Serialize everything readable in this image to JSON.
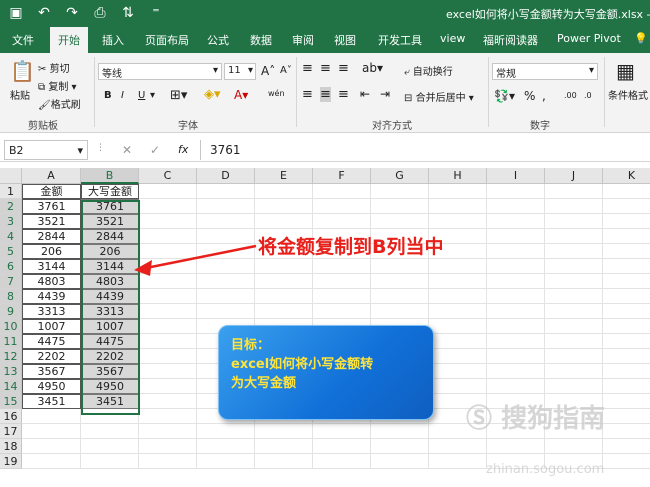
{
  "title_bar": {
    "doc_title": "excel如何将小写金额转为大写金额.xlsx - Exce",
    "qat": [
      "save-icon",
      "undo-icon",
      "redo-icon",
      "print-preview-icon",
      "sort-icon",
      "customize-icon"
    ]
  },
  "tabs": [
    "文件",
    "开始",
    "插入",
    "页面布局",
    "公式",
    "数据",
    "审阅",
    "视图",
    "开发工具",
    "view",
    "福昕阅读器",
    "Power Pivot",
    "💡"
  ],
  "active_tab_index": 1,
  "ribbon": {
    "clipboard": {
      "paste": "粘贴",
      "cut": "剪切",
      "copy": "复制",
      "format_painter": "格式刷",
      "label": "剪贴板"
    },
    "font": {
      "name": "等线",
      "size": "11",
      "grow": "A",
      "shrink": "A",
      "bold": "B",
      "italic": "I",
      "underline": "U",
      "wen": "wén",
      "color_a": "A",
      "label": "字体"
    },
    "alignment": {
      "wrap": "自动换行",
      "merge": "合并后居中",
      "label": "对齐方式"
    },
    "number": {
      "format": "常规",
      "percent": "%",
      "comma": ",",
      "inc_dec": ".00",
      "dec_dec": ".0",
      "label": "数字"
    },
    "styles": {
      "conditional": "条件格式"
    }
  },
  "formula_bar": {
    "name_box": "B2",
    "cancel": "✕",
    "enter": "✓",
    "fx": "fx",
    "value": "3761"
  },
  "sheet": {
    "columns": [
      "A",
      "B",
      "C",
      "D",
      "E",
      "F",
      "G",
      "H",
      "I",
      "J",
      "K"
    ],
    "rows": [
      "1",
      "2",
      "3",
      "4",
      "5",
      "6",
      "7",
      "8",
      "9",
      "10",
      "11",
      "12",
      "13",
      "14",
      "15",
      "16",
      "17",
      "18",
      "19"
    ],
    "headers": [
      "金额",
      "大写金额"
    ],
    "values_a": [
      "3761",
      "3521",
      "2844",
      "206",
      "3144",
      "4803",
      "4439",
      "3313",
      "1007",
      "4475",
      "2202",
      "3567",
      "4950",
      "3451"
    ],
    "values_b": [
      "3761",
      "3521",
      "2844",
      "206",
      "3144",
      "4803",
      "4439",
      "3313",
      "1007",
      "4475",
      "2202",
      "3567",
      "4950",
      "3451"
    ]
  },
  "annotation": {
    "text": "将金额复制到B列当中",
    "color": "#e8201b"
  },
  "callout": {
    "line1": "目标：",
    "line2": "excel如何将小写金额转",
    "line3": "为大写金额",
    "text_color": "#ffe43a"
  },
  "watermark": {
    "main": "搜狗指南",
    "sub": "zhinan.sogou.com"
  },
  "colors": {
    "brand": "#217346",
    "selection_border": "#217346"
  }
}
